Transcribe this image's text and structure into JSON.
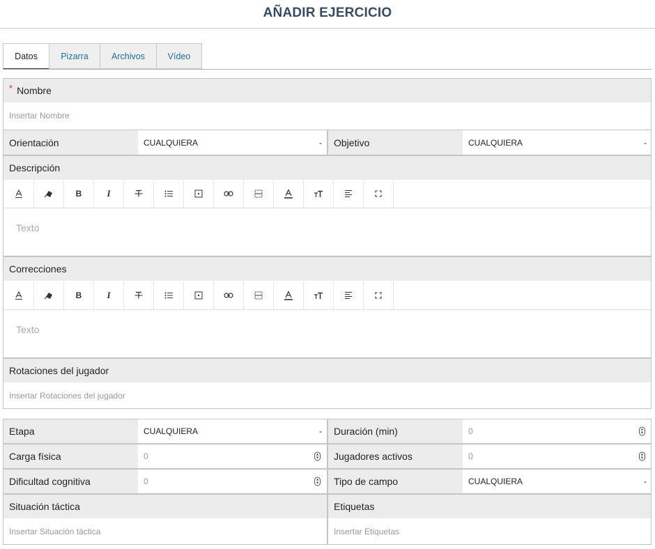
{
  "header": {
    "title": "AÑADIR EJERCICIO"
  },
  "tabs": [
    {
      "label": "Datos"
    },
    {
      "label": "Pizarra"
    },
    {
      "label": "Archivos"
    },
    {
      "label": "Vídeo"
    }
  ],
  "form": {
    "nombre": {
      "required_mark": "*",
      "label": "Nombre",
      "placeholder": "Insertar Nombre"
    },
    "orientacion": {
      "label": "Orientación",
      "value": "CUALQUIERA",
      "caret": "-"
    },
    "objetivo": {
      "label": "Objetivo",
      "value": "CUALQUIERA",
      "caret": "-"
    },
    "descripcion": {
      "label": "Descripción",
      "placeholder": "Texto"
    },
    "correcciones": {
      "label": "Correcciones",
      "placeholder": "Texto"
    },
    "rotaciones": {
      "label": "Rotaciones del jugador",
      "placeholder": "Insertar Rotaciones del jugador"
    },
    "etapa": {
      "label": "Etapa",
      "value": "CUALQUIERA",
      "caret": "-"
    },
    "duracion": {
      "label": "Duración (min)",
      "value": "0"
    },
    "carga": {
      "label": "Carga física",
      "value": "0"
    },
    "jugadores": {
      "label": "Jugadores activos",
      "value": "0"
    },
    "dificultad": {
      "label": "Dificultad cognitiva",
      "value": "0"
    },
    "tipo_campo": {
      "label": "Tipo de campo",
      "value": "CUALQUIERA",
      "caret": "-"
    },
    "situacion": {
      "label": "Situación táctica",
      "placeholder": "Insertar Situación táctica"
    },
    "etiquetas": {
      "label": "Etiquetas",
      "placeholder": "Insertar Etiquetas"
    }
  },
  "toolbar_icons": [
    "text-color-icon",
    "highlight-icon",
    "bold-icon",
    "italic-icon",
    "strikethrough-icon",
    "bullet-list-icon",
    "table-icon",
    "link-icon",
    "grid-icon",
    "font-color-icon",
    "font-size-icon",
    "align-icon",
    "fullscreen-icon"
  ],
  "toolbar_glyphs": {
    "bold": "B",
    "italic": "I"
  },
  "colors": {
    "title": "#3a4a5e",
    "tab_link": "#1f6fa0",
    "label_bg": "#ececec",
    "border": "#c4c4c4",
    "required": "#c0392b"
  }
}
